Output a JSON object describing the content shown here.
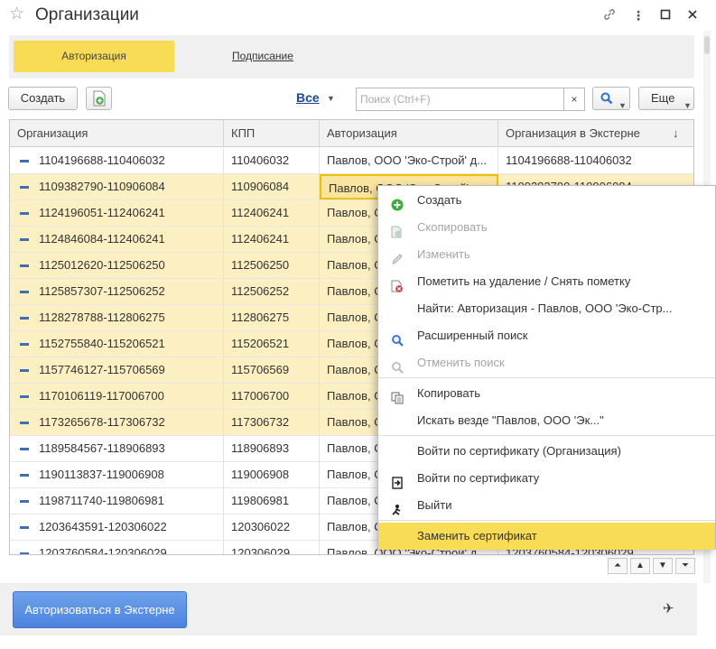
{
  "window": {
    "title": "Организации",
    "star_glyph": "☆",
    "link_glyph": "🔗",
    "more_glyph": "⋮",
    "maximize_glyph": "□",
    "close_glyph": "✕"
  },
  "tabs": [
    {
      "label": "Авторизация",
      "active": true
    },
    {
      "label": "Подписание",
      "active": false
    }
  ],
  "toolbar": {
    "create_label": "Создать",
    "filter_label": "Все",
    "search_placeholder": "Поиск (Ctrl+F)",
    "search_clear": "×",
    "more_label": "Еще"
  },
  "table": {
    "columns": [
      "Организация",
      "КПП",
      "Авторизация",
      "Организация в Экстерне"
    ],
    "sort_glyph": "↓",
    "rows": [
      {
        "org": "1104196688-110406032",
        "kpp": "110406032",
        "auth": "Павлов, ООО 'Эко-Строй' д...",
        "ext": "1104196688-110406032",
        "hl": false
      },
      {
        "org": "1109382790-110906084",
        "kpp": "110906084",
        "auth": "Павлов, ООО 'Эко-Строй' д...",
        "ext": "1109382790-110906084",
        "hl": true
      },
      {
        "org": "1124196051-112406241",
        "kpp": "112406241",
        "auth": "Павлов, ООО 'Эко-Строй' д...",
        "ext": "",
        "hl": true
      },
      {
        "org": "1124846084-112406241",
        "kpp": "112406241",
        "auth": "Павлов, ООО 'Эко-Строй' д...",
        "ext": "",
        "hl": true
      },
      {
        "org": "1125012620-112506250",
        "kpp": "112506250",
        "auth": "Павлов, ООО 'Эко-Строй' д...",
        "ext": "",
        "hl": true
      },
      {
        "org": "1125857307-112506252",
        "kpp": "112506252",
        "auth": "Павлов, ООО 'Эко-Строй' д...",
        "ext": "",
        "hl": true
      },
      {
        "org": "1128278788-112806275",
        "kpp": "112806275",
        "auth": "Павлов, ООО 'Эко-Строй' д...",
        "ext": "",
        "hl": true
      },
      {
        "org": "1152755840-115206521",
        "kpp": "115206521",
        "auth": "Павлов, ООО 'Эко-Строй' д...",
        "ext": "",
        "hl": true
      },
      {
        "org": "1157746127-115706569",
        "kpp": "115706569",
        "auth": "Павлов, ООО 'Эко-Строй' д...",
        "ext": "",
        "hl": true
      },
      {
        "org": "1170106119-117006700",
        "kpp": "117006700",
        "auth": "Павлов, ООО 'Эко-Строй' д...",
        "ext": "",
        "hl": true
      },
      {
        "org": "1173265678-117306732",
        "kpp": "117306732",
        "auth": "Павлов, ООО 'Эко-Строй' д...",
        "ext": "",
        "hl": true
      },
      {
        "org": "1189584567-118906893",
        "kpp": "118906893",
        "auth": "Павлов, ООО 'Эко-Строй' д...",
        "ext": "",
        "hl": false
      },
      {
        "org": "1190113837-119006908",
        "kpp": "119006908",
        "auth": "Павлов, ООО 'Эко-Строй' д...",
        "ext": "",
        "hl": false
      },
      {
        "org": "1198711740-119806981",
        "kpp": "119806981",
        "auth": "Павлов, ООО 'Эко-Строй' д...",
        "ext": "",
        "hl": false
      },
      {
        "org": "1203643591-120306022",
        "kpp": "120306022",
        "auth": "Павлов, ООО 'Эко-Строй' д...",
        "ext": "",
        "hl": false
      },
      {
        "org": "1203760584-120306029",
        "kpp": "120306029",
        "auth": "Павлов, ООО 'Эко-Строй' д...",
        "ext": "1203760584-120306029",
        "hl": false
      }
    ]
  },
  "context_menu": {
    "items": [
      {
        "label": "Создать",
        "icon": "plus-circle-icon",
        "disabled": false
      },
      {
        "label": "Скопировать",
        "icon": "copy-doc-icon",
        "disabled": true
      },
      {
        "label": "Изменить",
        "icon": "pencil-icon",
        "disabled": true
      },
      {
        "label": "Пометить на удаление / Снять пометку",
        "icon": "delete-mark-icon",
        "disabled": false
      },
      {
        "label": "Найти: Авторизация - Павлов, ООО 'Эко-Стр...",
        "icon": "",
        "disabled": false
      },
      {
        "label": "Расширенный поиск",
        "icon": "advanced-search-icon",
        "disabled": false
      },
      {
        "label": "Отменить поиск",
        "icon": "cancel-search-icon",
        "disabled": true
      },
      {
        "label": "Копировать",
        "icon": "copy-icon",
        "disabled": false
      },
      {
        "label": "Искать везде \"Павлов, ООО 'Эк...\"",
        "icon": "",
        "disabled": false
      },
      {
        "label": "Войти по сертификату (Организация)",
        "icon": "",
        "disabled": false
      },
      {
        "label": "Войти по сертификату",
        "icon": "login-icon",
        "disabled": false
      },
      {
        "label": "Выйти",
        "icon": "logout-icon",
        "disabled": false
      },
      {
        "label": "Заменить сертификат",
        "icon": "",
        "disabled": false,
        "selected": true
      }
    ]
  },
  "pager": {
    "first": "⏶",
    "up": "▲",
    "down": "▼",
    "last": "⏷"
  },
  "footer": {
    "authorize_label": "Авторизоваться в Экстерне",
    "send_glyph": "✈"
  },
  "colors": {
    "accent_yellow": "#f9dc55",
    "row_highlight": "#fcefc2",
    "primary_blue": "#4c83de",
    "link_blue": "#1c4a94"
  }
}
